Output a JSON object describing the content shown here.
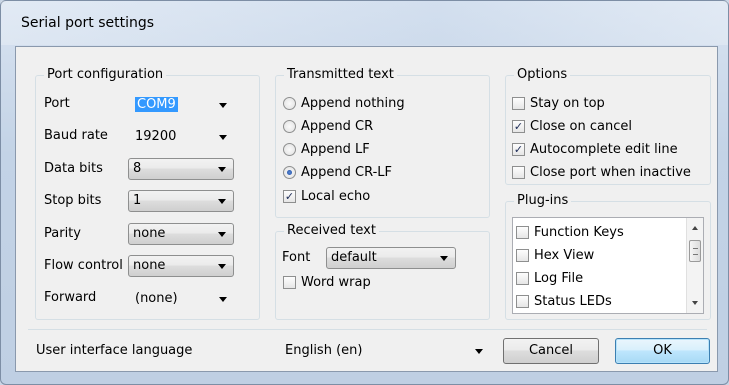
{
  "window": {
    "title": "Serial port settings"
  },
  "port_config": {
    "title": "Port configuration",
    "port": {
      "label": "Port",
      "value": "COM9"
    },
    "baud_rate": {
      "label": "Baud rate",
      "value": "19200"
    },
    "data_bits": {
      "label": "Data bits",
      "value": "8"
    },
    "stop_bits": {
      "label": "Stop bits",
      "value": "1"
    },
    "parity": {
      "label": "Parity",
      "value": "none"
    },
    "flow_control": {
      "label": "Flow control",
      "value": "none"
    },
    "forward": {
      "label": "Forward",
      "value": "(none)"
    }
  },
  "transmitted": {
    "title": "Transmitted text",
    "options": [
      {
        "label": "Append nothing",
        "selected": false
      },
      {
        "label": "Append CR",
        "selected": false
      },
      {
        "label": "Append LF",
        "selected": false
      },
      {
        "label": "Append CR-LF",
        "selected": true
      }
    ],
    "local_echo": {
      "label": "Local echo",
      "checked": true
    }
  },
  "received": {
    "title": "Received text",
    "font_label": "Font",
    "font_value": "default",
    "word_wrap": {
      "label": "Word wrap",
      "checked": false
    }
  },
  "options": {
    "title": "Options",
    "items": [
      {
        "label": "Stay on top",
        "checked": false
      },
      {
        "label": "Close on cancel",
        "checked": true
      },
      {
        "label": "Autocomplete edit line",
        "checked": true
      },
      {
        "label": "Close port when inactive",
        "checked": false
      }
    ]
  },
  "plugins": {
    "title": "Plug-ins",
    "items": [
      {
        "label": "Function Keys",
        "checked": false
      },
      {
        "label": "Hex View",
        "checked": false
      },
      {
        "label": "Log File",
        "checked": false
      },
      {
        "label": "Status LEDs",
        "checked": false
      }
    ]
  },
  "footer": {
    "language_label": "User interface language",
    "language_value": "English (en)",
    "cancel_label": "Cancel",
    "ok_label": "OK"
  },
  "icons": {
    "check_glyph": "✓",
    "dropdown": "chevron-down-icon"
  }
}
